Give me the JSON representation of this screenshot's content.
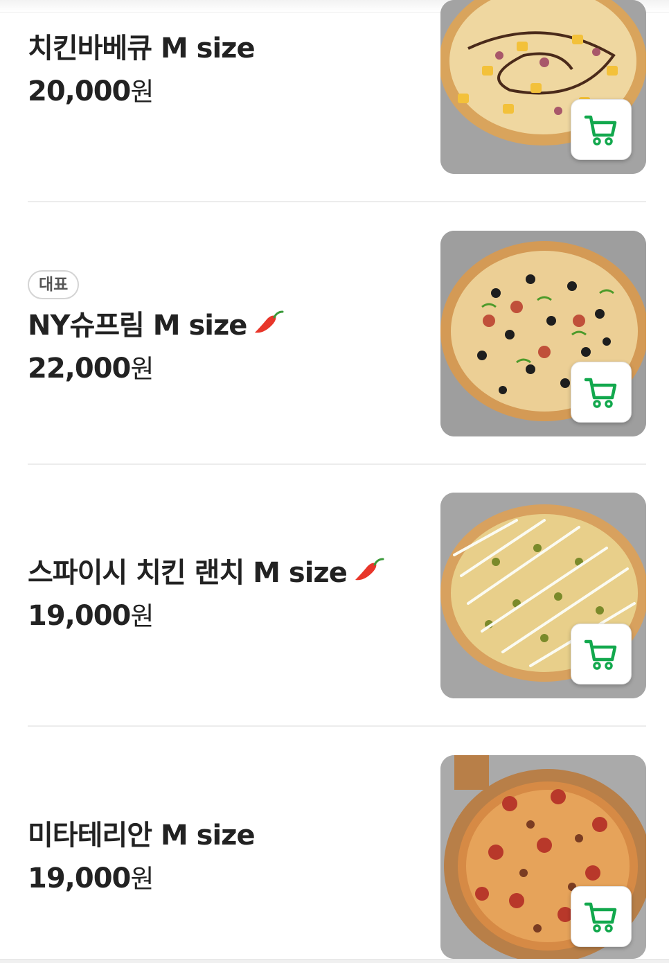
{
  "theme": {
    "accent": "#12a84d",
    "text": "#222222",
    "pepper": "#e8362a"
  },
  "menu": {
    "items": [
      {
        "badge": "",
        "name": "치킨바베큐 M size",
        "spicy": false,
        "price_number": "20,000",
        "price_unit": "원",
        "icon": "cart-icon"
      },
      {
        "badge": "대표",
        "name": "NY슈프림 M size",
        "spicy": true,
        "price_number": "22,000",
        "price_unit": "원",
        "icon": "cart-icon"
      },
      {
        "badge": "",
        "name": "스파이시 치킨 랜치 M size",
        "spicy": true,
        "price_number": "19,000",
        "price_unit": "원",
        "icon": "cart-icon"
      },
      {
        "badge": "",
        "name": "미타테리안 M size",
        "spicy": false,
        "price_number": "19,000",
        "price_unit": "원",
        "icon": "cart-icon"
      }
    ]
  }
}
